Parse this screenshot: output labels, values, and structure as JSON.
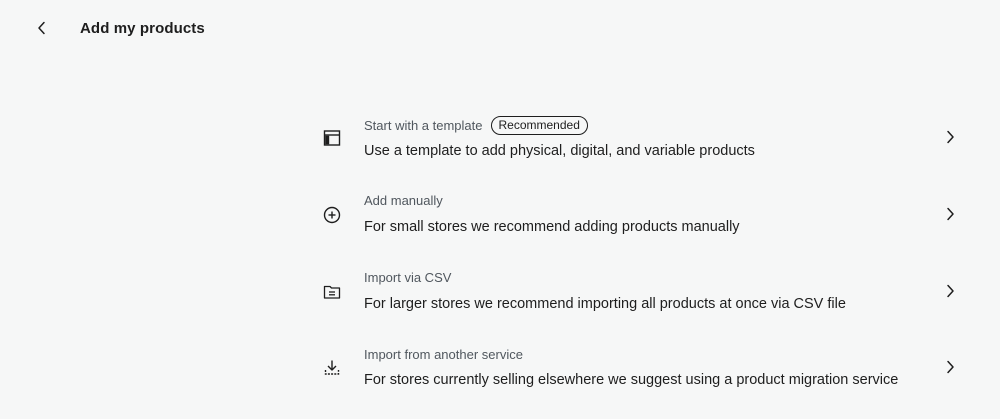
{
  "header": {
    "title": "Add my products",
    "back_icon": "chevron-left-icon"
  },
  "options": [
    {
      "icon": "template-icon",
      "title": "Start with a template",
      "badge": "Recommended",
      "description": "Use a template to add physical, digital, and variable products"
    },
    {
      "icon": "plus-circle-icon",
      "title": "Add manually",
      "description": "For small stores we recommend adding products manually"
    },
    {
      "icon": "csv-file-icon",
      "title": "Import via CSV",
      "description": "For larger stores we recommend importing all products at once via CSV file"
    },
    {
      "icon": "download-icon",
      "title": "Import from another service",
      "description": "For stores currently selling elsewhere we suggest using a product migration service"
    }
  ],
  "colors": {
    "background": "#f6f7f7",
    "text": "#1e1e1e",
    "muted": "#50575e"
  }
}
